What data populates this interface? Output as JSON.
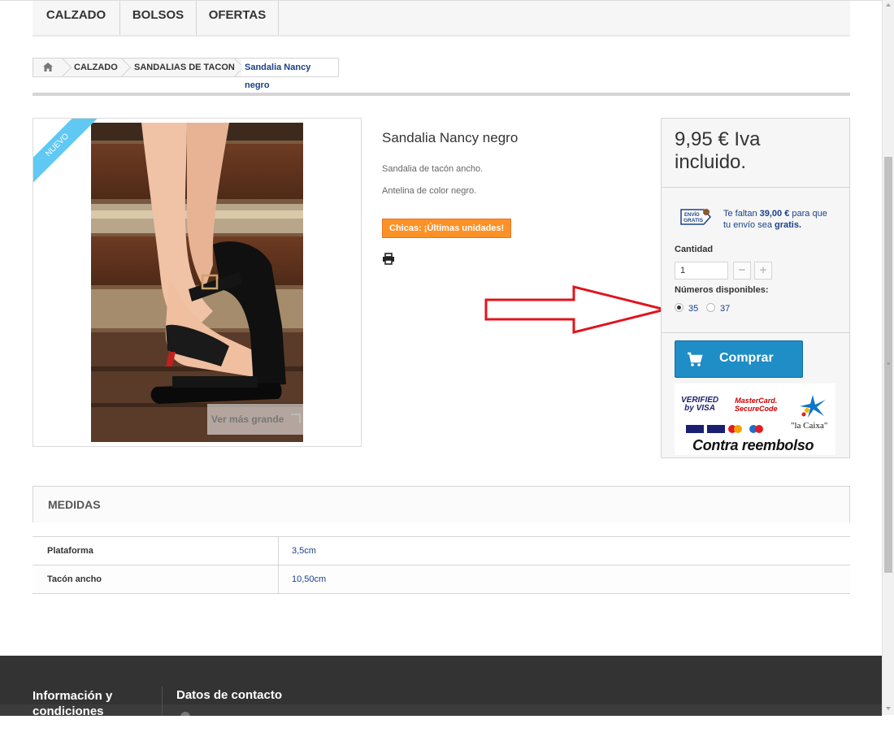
{
  "menu": {
    "items": [
      "CALZADO",
      "BOLSOS",
      "OFERTAS"
    ]
  },
  "breadcrumb": {
    "items": [
      "CALZADO",
      "SANDALIAS DE TACON"
    ],
    "current": "Sandalia Nancy negro"
  },
  "product": {
    "ribbon": "NUEVO",
    "zoom_label": "Ver más grande",
    "title": "Sandalia Nancy negro",
    "description": [
      "Sandalia de tacón ancho.",
      "Antelina de color negro."
    ],
    "stock_badge": "Chicas: ¡Últimas unidades!",
    "print_icon": "printer-icon"
  },
  "buybox": {
    "price": "9,95 € Iva incluido.",
    "shipping": {
      "icon_text": "ENVÍO GRATIS",
      "prefix": "Te faltan ",
      "amount": "39,00 €",
      "middle": " para que tu envío sea ",
      "suffix": "gratis."
    },
    "quantity_label": "Cantidad",
    "quantity_value": "1",
    "minus": "−",
    "plus": "+",
    "sizes_label": "Números disponibles:",
    "sizes": [
      {
        "label": "35",
        "selected": true
      },
      {
        "label": "37",
        "selected": false
      }
    ],
    "buy_label": "Comprar",
    "payment": {
      "visa_1": "VERIFIED",
      "visa_2": "by VISA",
      "mc_1": "MasterCard.",
      "mc_2": "SecureCode",
      "caixa": "\"la Caixa\"",
      "reembolso": "Contra reembolso"
    }
  },
  "medidas": {
    "title": "MEDIDAS",
    "rows": [
      {
        "key": "Plataforma",
        "value": "3,5cm"
      },
      {
        "key": "Tacón ancho",
        "value": "10,50cm"
      }
    ]
  },
  "footer": {
    "col1": "Información y condiciones",
    "col2": "Datos de contacto"
  },
  "colors": {
    "accent": "#1f8dc6",
    "link": "#1b4188",
    "badge": "#fe9126",
    "ribbon": "#5fc8f3",
    "arrow": "#e0141e",
    "footer": "#333333"
  }
}
